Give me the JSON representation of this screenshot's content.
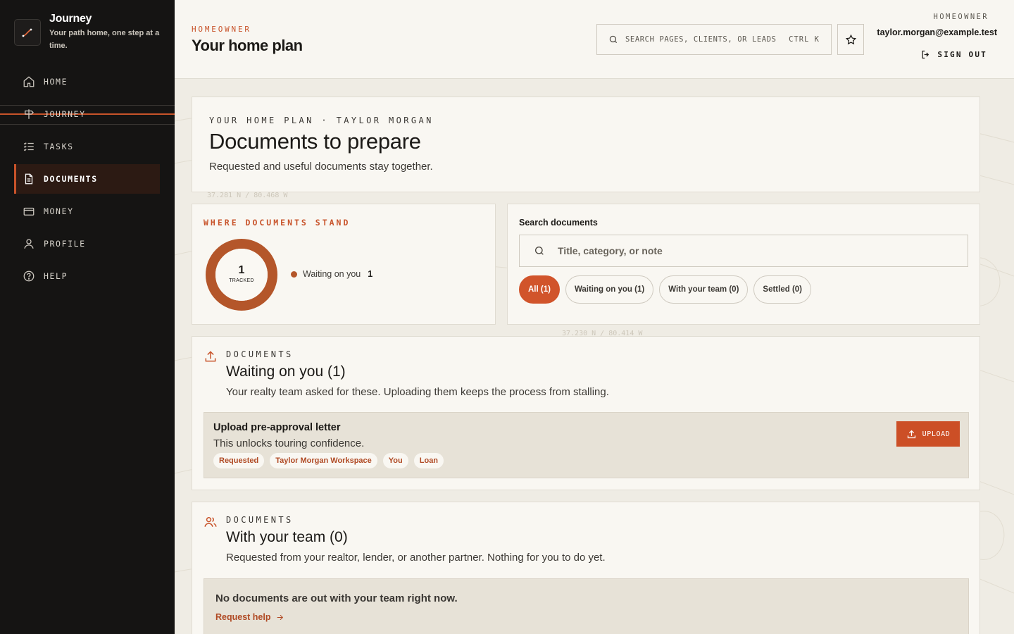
{
  "brand": {
    "title": "Journey",
    "tagline": "Your path home, one step at a time."
  },
  "nav": [
    {
      "label": "HOME",
      "icon": "home-icon"
    },
    {
      "label": "JOURNEY",
      "icon": "signpost-icon"
    },
    {
      "label": "TASKS",
      "icon": "checklist-icon"
    },
    {
      "label": "DOCUMENTS",
      "icon": "document-icon",
      "active": true
    },
    {
      "label": "MONEY",
      "icon": "credit-card-icon"
    },
    {
      "label": "PROFILE",
      "icon": "user-icon"
    },
    {
      "label": "HELP",
      "icon": "help-circle-icon"
    }
  ],
  "header": {
    "eyebrow": "HOMEOWNER",
    "title": "Your home plan",
    "search_placeholder": "SEARCH PAGES, CLIENTS, OR LEADS",
    "search_shortcut": "CTRL K",
    "role": "HOMEOWNER",
    "email": "taylor.morgan@example.test",
    "signout": "SIGN OUT"
  },
  "hero": {
    "eyebrow": "YOUR HOME PLAN · TAYLOR MORGAN",
    "title": "Documents to prepare",
    "subtitle": "Requested and useful documents stay together."
  },
  "map_labels": [
    "37.281 N / 80.468 W",
    "37.230 N / 80.414 W"
  ],
  "stand": {
    "title": "WHERE DOCUMENTS STAND",
    "total": "1",
    "total_label": "TRACKED",
    "legend": [
      {
        "label": "Waiting on you",
        "count": "1",
        "color": "#b4562a"
      }
    ]
  },
  "doc_search": {
    "label": "Search documents",
    "placeholder": "Title, category, or note",
    "filters": [
      {
        "label": "All (1)",
        "active": true
      },
      {
        "label": "Waiting on you (1)"
      },
      {
        "label": "With your team (0)"
      },
      {
        "label": "Settled (0)"
      }
    ]
  },
  "sections": {
    "waiting": {
      "eyebrow": "DOCUMENTS",
      "title": "Waiting on you (1)",
      "subtitle": "Your realty team asked for these. Uploading them keeps the process from stalling.",
      "item": {
        "title": "Upload pre-approval letter",
        "subtitle": "This unlocks touring confidence.",
        "tags": [
          "Requested",
          "Taylor Morgan Workspace",
          "You",
          "Loan"
        ],
        "action": "UPLOAD"
      }
    },
    "team": {
      "eyebrow": "DOCUMENTS",
      "title": "With your team (0)",
      "subtitle": "Requested from your realtor, lender, or another partner. Nothing for you to do yet.",
      "empty_title": "No documents are out with your team right now.",
      "empty_link": "Request help"
    }
  },
  "colors": {
    "accent": "#c8532a",
    "sidebar": "#151413",
    "surface": "#f9f7f2"
  }
}
